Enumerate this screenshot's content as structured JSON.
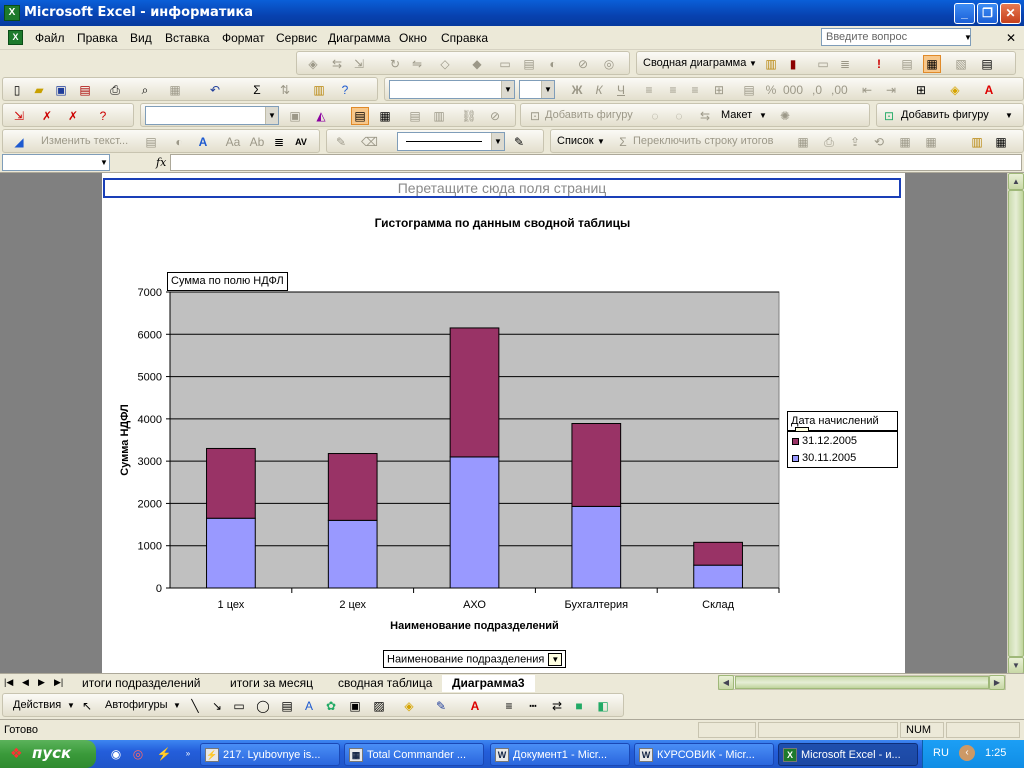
{
  "window": {
    "title": "Microsoft Excel - информатика",
    "app_icon": "X"
  },
  "menu": {
    "items": [
      "Файл",
      "Правка",
      "Вид",
      "Вставка",
      "Формат",
      "Сервис",
      "Диаграмма",
      "Окно",
      "Справка"
    ],
    "help_placeholder": "Введите вопрос"
  },
  "toolbars": {
    "pivot_chart_menu": "Сводная диаграмма",
    "add_shape_1": "Добавить фигуру",
    "layout": "Макет",
    "add_shape_2": "Добавить фигуру",
    "edit_text": "Изменить текст...",
    "list": "Список",
    "switch_totals": "Переключить строку итогов"
  },
  "formula": {
    "fx": "fx",
    "name_box": ""
  },
  "chart": {
    "page_fields_hint": "Перетащите сюда поля страниц",
    "data_field": "Сумма по полю НДФЛ",
    "legend_field": "Дата начислений",
    "category_field": "Наименование подразделения"
  },
  "chart_data": {
    "type": "bar",
    "stacked": true,
    "title": "Гистограмма по данным сводной таблицы",
    "xlabel": "Наименование подразделений",
    "ylabel": "Сумма НДФЛ",
    "categories": [
      "1 цех",
      "2 цех",
      "АХО",
      "Бухгалтерия",
      "Склад"
    ],
    "series": [
      {
        "name": "30.11.2005",
        "color": "#9999ff",
        "values": [
          1650,
          1600,
          3100,
          1930,
          540
        ]
      },
      {
        "name": "31.12.2005",
        "color": "#993366",
        "values": [
          1650,
          1580,
          3050,
          1960,
          540
        ]
      }
    ],
    "legend_order": [
      "31.12.2005",
      "30.11.2005"
    ],
    "ylim": [
      0,
      7000
    ],
    "yticks": [
      0,
      1000,
      2000,
      3000,
      4000,
      5000,
      6000,
      7000
    ],
    "grid": true,
    "plot_background": "#c0c0c0",
    "legend_position": "right"
  },
  "sheets": {
    "tabs": [
      "итоги подразделений",
      "итоги за месяц",
      "сводная таблица",
      "Диаграмма3"
    ],
    "active": "Диаграмма3"
  },
  "drawing": {
    "actions": "Действия",
    "autoshapes": "Автофигуры"
  },
  "status": {
    "ready": "Готово",
    "num": "NUM"
  },
  "taskbar": {
    "start": "пуск",
    "tasks": [
      "217. Lyubovnye is...",
      "Total Commander ...",
      "Документ1 - Micr...",
      "КУРСОВИК - Micr...",
      "Microsoft Excel - и..."
    ],
    "lang": "RU",
    "clock": "1:25"
  }
}
